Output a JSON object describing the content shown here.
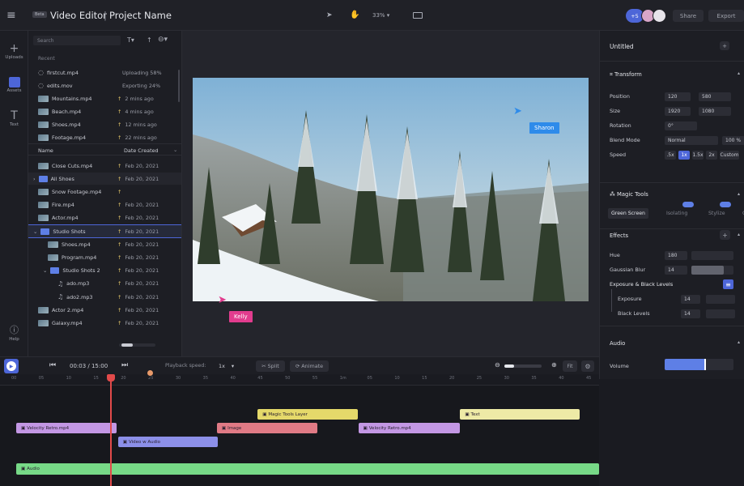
{
  "topbar": {
    "badge": "Beta",
    "app_title": "Video Editor",
    "separator": "|",
    "project_name": "Project Name",
    "zoom": "33% ▾",
    "collab_count": "+5",
    "share_label": "Share",
    "export_label": "Export"
  },
  "rail": {
    "items": [
      {
        "label": "Uploads",
        "icon": "plus-icon"
      },
      {
        "label": "Assets",
        "icon": "assets-icon"
      },
      {
        "label": "Text",
        "icon": "text-icon"
      }
    ],
    "help_label": "Help"
  },
  "assets": {
    "search_placeholder": "Search",
    "recent_heading": "Recent",
    "recent": [
      {
        "name": "firstcut.mp4",
        "status": "Uploading 58%",
        "kind": "loading"
      },
      {
        "name": "edits.mov",
        "status": "Exporting 24%",
        "kind": "loading"
      },
      {
        "name": "Mountains.mp4",
        "status": "2 mins ago",
        "kind": "thumb"
      },
      {
        "name": "Beach.mp4",
        "status": "4 mins ago",
        "kind": "thumb"
      },
      {
        "name": "Shoes.mp4",
        "status": "12 mins ago",
        "kind": "thumb"
      },
      {
        "name": "Footage.mp4",
        "status": "22 mins ago",
        "kind": "thumb"
      }
    ],
    "col_name": "Name",
    "col_date": "Date Created",
    "files": [
      {
        "name": "Close Cuts.mp4",
        "date": "Feb 20, 2021",
        "indent": 0,
        "kind": "thumb"
      },
      {
        "name": "All Shoes",
        "date": "Feb 20, 2021",
        "indent": 0,
        "kind": "folder"
      },
      {
        "name": "Snow Footage.mp4",
        "date": "",
        "indent": 0,
        "kind": "thumb"
      },
      {
        "name": "Fire.mp4",
        "date": "Feb 20, 2021",
        "indent": 0,
        "kind": "thumb"
      },
      {
        "name": "Actor.mp4",
        "date": "Feb 20, 2021",
        "indent": 0,
        "kind": "thumb"
      },
      {
        "name": "Studio Shots",
        "date": "Feb 20, 2021",
        "indent": 0,
        "kind": "folder"
      },
      {
        "name": "Shoes.mp4",
        "date": "Feb 20, 2021",
        "indent": 1,
        "kind": "thumb"
      },
      {
        "name": "Program.mp4",
        "date": "Feb 20, 2021",
        "indent": 1,
        "kind": "thumb"
      },
      {
        "name": "Studio Shots 2",
        "date": "Feb 20, 2021",
        "indent": 1,
        "kind": "folder"
      },
      {
        "name": "ado.mp3",
        "date": "Feb 20, 2021",
        "indent": 2,
        "kind": "audio"
      },
      {
        "name": "ado2.mp3",
        "date": "Feb 20, 2021",
        "indent": 2,
        "kind": "audio"
      },
      {
        "name": "Actor 2.mp4",
        "date": "Feb 20, 2021",
        "indent": 0,
        "kind": "thumb"
      },
      {
        "name": "Galaxy.mp4",
        "date": "Feb 20, 2021",
        "indent": 0,
        "kind": "thumb"
      }
    ]
  },
  "stage": {
    "cursor_sharon": "Sharon",
    "cursor_kelly": "Kelly",
    "colors": {
      "sharon": "#2e8bea",
      "kelly": "#e23c8e"
    }
  },
  "inspector": {
    "title": "Untitled",
    "transform": {
      "heading": "Transform",
      "position_label": "Position",
      "position_x": "120",
      "position_y": "580",
      "size_label": "Size",
      "size_w": "1920",
      "size_h": "1080",
      "rotation_label": "Rotation",
      "rotation_val": "0°",
      "blend_label": "Blend Mode",
      "blend_val": "Normal",
      "blend_pct": "100 %",
      "speed_label": "Speed",
      "speeds": [
        ".5x",
        "1x",
        "1.5x",
        "2x",
        "Custom"
      ]
    },
    "magic": {
      "heading": "Magic Tools",
      "tabs": [
        "Green Screen",
        "Isolating",
        "Stylize",
        "C"
      ]
    },
    "effects": {
      "heading": "Effects",
      "hue_label": "Hue",
      "hue_val": "180",
      "blur_label": "Gaussian Blur",
      "blur_val": "14",
      "exposure_heading": "Exposure & Black Levels",
      "exposure_label": "Exposure",
      "exposure_val": "14",
      "black_label": "Black Levels",
      "black_val": "14"
    },
    "audio": {
      "heading": "Audio",
      "volume_label": "Volume",
      "volume_level": 0.6
    }
  },
  "transport": {
    "timecode": "00:03 / 15:00",
    "speed_label": "Playback speed:",
    "speed_val": "1x",
    "split_label": "Split",
    "animate_label": "Animate",
    "fit_label": "Fit"
  },
  "ruler": {
    "ticks": [
      "00",
      "05",
      "10",
      "15",
      "20",
      "25",
      "30",
      "35",
      "40",
      "45",
      "50",
      "55",
      "1m",
      "05",
      "10",
      "15",
      "20",
      "25",
      "30",
      "35",
      "40",
      "45"
    ]
  },
  "timeline": {
    "clips": [
      {
        "label": "Magic Tools Layer",
        "color": "#e5d96a",
        "track": 0,
        "start": 0.43,
        "end": 0.597
      },
      {
        "label": "Text",
        "color": "#eeeaa6",
        "track": 0,
        "start": 0.768,
        "end": 0.968
      },
      {
        "label": "Velocity Retro.mp4",
        "color": "#c397e4",
        "track": 1,
        "start": 0.027,
        "end": 0.195
      },
      {
        "label": "Image",
        "color": "#e07a85",
        "track": 1,
        "start": 0.362,
        "end": 0.53
      },
      {
        "label": "Velocity Retro.mp4",
        "color": "#c397e4",
        "track": 1,
        "start": 0.598,
        "end": 0.767
      },
      {
        "label": "Video w Audio",
        "color": "#8c8fe8",
        "track": 2,
        "start": 0.197,
        "end": 0.364
      },
      {
        "label": "Audio",
        "color": "#77d987",
        "track": 3,
        "start": 0.027,
        "end": 1.0
      }
    ],
    "playhead_pos": 0.184
  }
}
